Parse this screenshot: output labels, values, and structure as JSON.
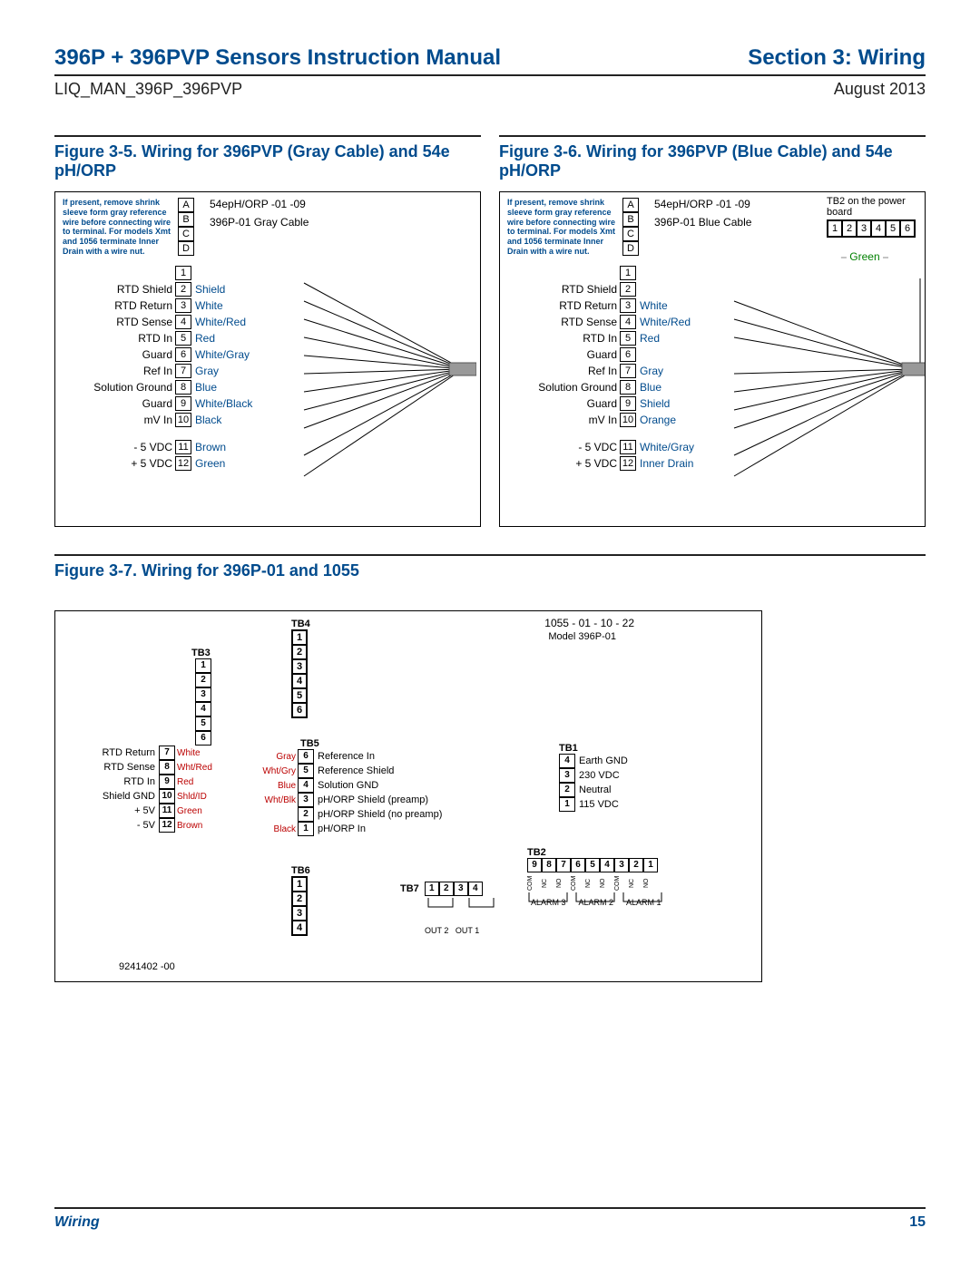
{
  "header": {
    "title": "396P + 396PVP Sensors Instruction Manual",
    "section": "Section 3: Wiring",
    "docid": "LIQ_MAN_396P_396PVP",
    "date": "August 2013"
  },
  "footer": {
    "section": "Wiring",
    "page": "15"
  },
  "fig5": {
    "caption": "Figure 3-5. Wiring for 396PVP (Gray Cable) and 54e pH/ORP",
    "note": "If present, remove shrink sleeve form gray reference wire before connecting wire to terminal.  For models Xmt and 1056 terminate Inner Drain with a wire nut.",
    "model": "54epH/ORP  -01  -09",
    "cable": "396P-01 Gray Cable",
    "letters": [
      "A",
      "B",
      "C",
      "D"
    ],
    "pins": [
      {
        "n": "1",
        "label": "",
        "wire": ""
      },
      {
        "n": "2",
        "label": "RTD Shield",
        "wire": "Shield"
      },
      {
        "n": "3",
        "label": "RTD Return",
        "wire": "White"
      },
      {
        "n": "4",
        "label": "RTD Sense",
        "wire": "White/Red"
      },
      {
        "n": "5",
        "label": "RTD In",
        "wire": "Red"
      },
      {
        "n": "6",
        "label": "Guard",
        "wire": "White/Gray"
      },
      {
        "n": "7",
        "label": "Ref In",
        "wire": "Gray"
      },
      {
        "n": "8",
        "label": "Solution Ground",
        "wire": "Blue"
      },
      {
        "n": "9",
        "label": "Guard",
        "wire": "White/Black"
      },
      {
        "n": "10",
        "label": "mV In",
        "wire": "Black"
      },
      {
        "n": "11",
        "label": "- 5 VDC",
        "wire": "Brown"
      },
      {
        "n": "12",
        "label": "+ 5 VDC",
        "wire": "Green"
      }
    ]
  },
  "fig6": {
    "caption": "Figure 3-6. Wiring for 396PVP (Blue Cable) and 54e pH/ORP",
    "note": "If present, remove shrink sleeve form gray reference wire before connecting wire to terminal.  For models Xmt and 1056 terminate Inner Drain with a wire nut.",
    "model": "54epH/ORP  -01  -09",
    "cable": "396P-01 Blue Cable",
    "tb2title": "TB2 on the power board",
    "tb2": [
      "1",
      "2",
      "3",
      "4",
      "5",
      "6"
    ],
    "greenlabel": "Green",
    "pins": [
      {
        "n": "1",
        "label": "",
        "wire": ""
      },
      {
        "n": "2",
        "label": "RTD Shield",
        "wire": ""
      },
      {
        "n": "3",
        "label": "RTD Return",
        "wire": "White"
      },
      {
        "n": "4",
        "label": "RTD Sense",
        "wire": "White/Red"
      },
      {
        "n": "5",
        "label": "RTD In",
        "wire": "Red"
      },
      {
        "n": "6",
        "label": "Guard",
        "wire": ""
      },
      {
        "n": "7",
        "label": "Ref In",
        "wire": "Gray"
      },
      {
        "n": "8",
        "label": "Solution Ground",
        "wire": "Blue"
      },
      {
        "n": "9",
        "label": "Guard",
        "wire": "Shield"
      },
      {
        "n": "10",
        "label": "mV In",
        "wire": "Orange"
      },
      {
        "n": "11",
        "label": "- 5 VDC",
        "wire": "White/Gray"
      },
      {
        "n": "12",
        "label": "+ 5 VDC",
        "wire": "Inner Drain"
      }
    ]
  },
  "fig7": {
    "caption": "Figure 3-7. Wiring for 396P-01 and 1055",
    "model": "1055  - 01   - 10    - 22",
    "submodel": "Model 396P-01",
    "partno": "9241402 -00",
    "tb3": {
      "name": "TB3",
      "rows": [
        {
          "n": "1"
        },
        {
          "n": "2"
        },
        {
          "n": "3"
        },
        {
          "n": "4"
        },
        {
          "n": "5"
        },
        {
          "n": "6"
        },
        {
          "n": "7",
          "l": "RTD Return",
          "w": "White"
        },
        {
          "n": "8",
          "l": "RTD Sense",
          "w": "Wht/Red"
        },
        {
          "n": "9",
          "l": "RTD In",
          "w": "Red"
        },
        {
          "n": "10",
          "l": "Shield GND",
          "w": "Shld/ID"
        },
        {
          "n": "11",
          "l": "+ 5V",
          "w": "Green"
        },
        {
          "n": "12",
          "l": "- 5V",
          "w": "Brown"
        }
      ]
    },
    "tb4": {
      "name": "TB4",
      "rows": [
        "1",
        "2",
        "3",
        "4",
        "5",
        "6"
      ]
    },
    "tb5": {
      "name": "TB5",
      "rows": [
        {
          "n": "6",
          "w": "Gray",
          "l": "Reference In"
        },
        {
          "n": "5",
          "w": "Wht/Gry",
          "l": "Reference Shield"
        },
        {
          "n": "4",
          "w": "Blue",
          "l": "Solution GND"
        },
        {
          "n": "3",
          "w": "Wht/Blk",
          "l": "pH/ORP Shield (preamp)"
        },
        {
          "n": "2",
          "w": "",
          "l": "pH/ORP Shield (no preamp)"
        },
        {
          "n": "1",
          "w": "Black",
          "l": "pH/ORP In"
        }
      ]
    },
    "tb6": {
      "name": "TB6",
      "rows": [
        "1",
        "2",
        "3",
        "4"
      ]
    },
    "tb7": {
      "name": "TB7",
      "rows": [
        "1",
        "2",
        "3",
        "4"
      ],
      "out2": "OUT 2",
      "out1": "OUT 1"
    },
    "tb1": {
      "name": "TB1",
      "rows": [
        {
          "n": "4",
          "l": "Earth GND"
        },
        {
          "n": "3",
          "l": "230 VDC"
        },
        {
          "n": "2",
          "l": "Neutral"
        },
        {
          "n": "1",
          "l": "115 VDC"
        }
      ]
    },
    "tb2": {
      "name": "TB2",
      "cells": [
        "9",
        "8",
        "7",
        "6",
        "5",
        "4",
        "3",
        "2",
        "1"
      ],
      "sub": [
        "COM",
        "NC",
        "NO",
        "COM",
        "NC",
        "NO",
        "COM",
        "NC",
        "NO"
      ],
      "alarms": [
        "ALARM 3",
        "ALARM 2",
        "ALARM 1"
      ]
    }
  }
}
